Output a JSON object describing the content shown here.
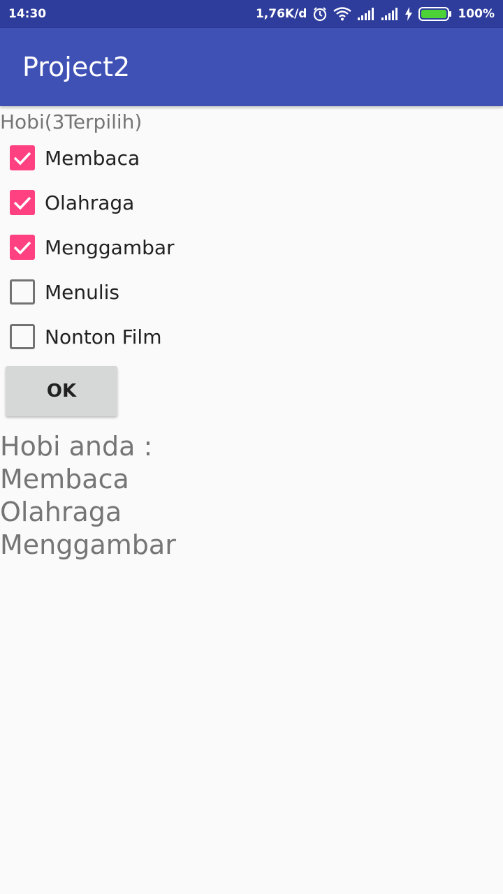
{
  "status_bar": {
    "time": "14:30",
    "network_speed": "1,76K/d",
    "battery": "100%",
    "icons": [
      "alarm-icon",
      "wifi-icon",
      "signal-icon",
      "signal-icon",
      "charging-icon",
      "battery-icon"
    ]
  },
  "app_bar": {
    "title": "Project2"
  },
  "form": {
    "heading": "Hobi(3Terpilih)",
    "checkboxes": [
      {
        "label": "Membaca",
        "checked": true
      },
      {
        "label": "Olahraga",
        "checked": true
      },
      {
        "label": "Menggambar",
        "checked": true
      },
      {
        "label": "Menulis",
        "checked": false
      },
      {
        "label": "Nonton Film",
        "checked": false
      }
    ],
    "ok_label": "OK"
  },
  "result": {
    "lines": [
      "Hobi anda :",
      "Membaca",
      "Olahraga",
      "Menggambar"
    ]
  },
  "colors": {
    "primary": "#3f51b5",
    "primary_dark": "#2e3c9b",
    "accent": "#ff4081",
    "battery": "#4cd137"
  }
}
